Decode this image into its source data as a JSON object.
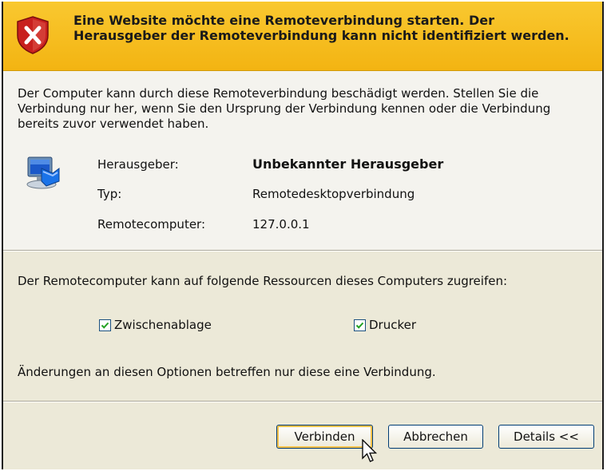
{
  "banner": {
    "title": "Eine Website möchte eine Remoteverbindung starten. Der Herausgeber der Remoteverbindung kann nicht identifiziert werden."
  },
  "info": {
    "warning": "Der Computer kann durch diese Remoteverbindung beschädigt werden. Stellen Sie die Verbindung nur her, wenn Sie den Ursprung der Verbindung kennen oder die Verbindung bereits zuvor verwendet haben.",
    "publisher_label": "Herausgeber:",
    "publisher_value": "Unbekannter Herausgeber",
    "type_label": "Typ:",
    "type_value": "Remotedesktopverbindung",
    "remote_label": "Remotecomputer:",
    "remote_value": "127.0.0.1"
  },
  "resources": {
    "intro": "Der Remotecomputer kann auf folgende Ressourcen dieses Computers zugreifen:",
    "clipboard_label": "Zwischenablage",
    "clipboard_checked": true,
    "printer_label": "Drucker",
    "printer_checked": true,
    "note": "Änderungen an diesen Optionen betreffen nur diese eine Verbindung."
  },
  "buttons": {
    "connect": "Verbinden",
    "cancel": "Abbrechen",
    "details": "Details <<"
  },
  "colors": {
    "banner": "#f3b412",
    "check": "#21a121",
    "shield_red": "#c8201e"
  }
}
